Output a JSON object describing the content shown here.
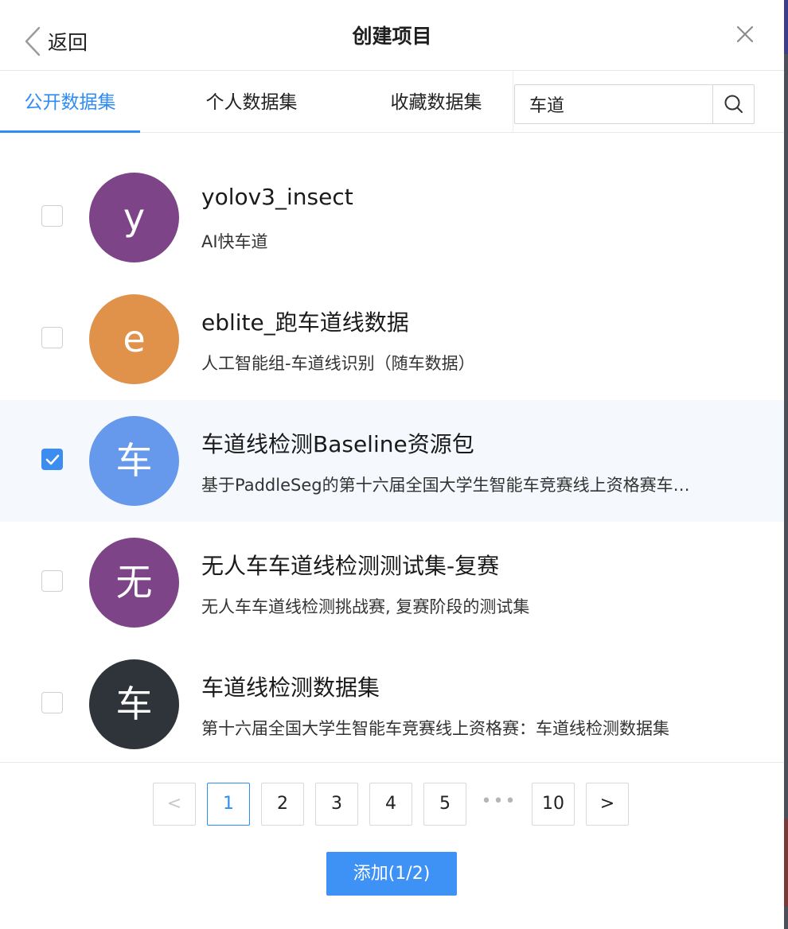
{
  "header": {
    "back_label": "返回",
    "title": "创建项目"
  },
  "tabs": [
    {
      "label": "公开数据集",
      "active": true
    },
    {
      "label": "个人数据集",
      "active": false
    },
    {
      "label": "收藏数据集",
      "active": false
    }
  ],
  "search": {
    "value": "车道",
    "icon": "search-icon"
  },
  "datasets": [
    {
      "avatar_letter": "y",
      "avatar_color": "#7d4587",
      "title": "yolov3_insect",
      "description": "AI快车道",
      "checked": false
    },
    {
      "avatar_letter": "e",
      "avatar_color": "#e0914a",
      "title": "eblite_跑车道线数据",
      "description": "人工智能组-车道线识别（随车数据）",
      "checked": false
    },
    {
      "avatar_letter": "车",
      "avatar_color": "#6699ec",
      "title": "车道线检测Baseline资源包",
      "description": "基于PaddleSeg的第十六届全国大学生智能车竞赛线上资格赛车道线检测Baseline",
      "checked": true
    },
    {
      "avatar_letter": "无",
      "avatar_color": "#7d4587",
      "title": "无人车车道线检测测试集-复赛",
      "description": "无人车车道线检测挑战赛, 复赛阶段的测试集",
      "checked": false
    },
    {
      "avatar_letter": "车",
      "avatar_color": "#2f343b",
      "title": "车道线检测数据集",
      "description": "第十六届全国大学生智能车竞赛线上资格赛：车道线检测数据集",
      "checked": false
    }
  ],
  "pagination": {
    "prev": "<",
    "pages": [
      "1",
      "2",
      "3",
      "4",
      "5"
    ],
    "ellipsis": "•••",
    "last": "10",
    "next": ">",
    "current": "1"
  },
  "add_button": "添加(1/2)",
  "colors": {
    "accent": "#2f8cf5",
    "button": "#3e91f5",
    "selected_row": "#f5f8fd"
  }
}
